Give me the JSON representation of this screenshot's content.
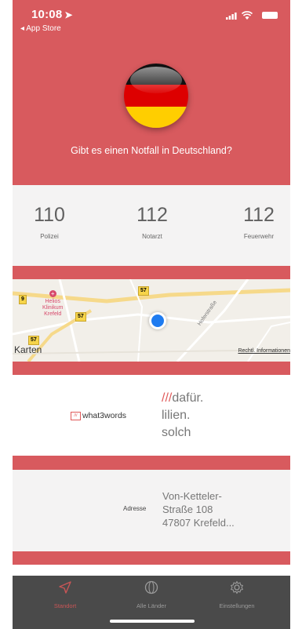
{
  "status_bar": {
    "time": "10:08",
    "back_app": "◂ App Store"
  },
  "header": {
    "question": "Gibt es einen Notfall in Deutschland?",
    "flag_colors": [
      "#000000",
      "#dd0000",
      "#ffce00"
    ]
  },
  "numbers": [
    {
      "number": "110",
      "label": "Polizei"
    },
    {
      "number": "112",
      "label": "Notarzt"
    },
    {
      "number": "112",
      "label": "Feuerwehr"
    }
  ],
  "map": {
    "logo": "Karten",
    "attribution": "Rechtl. Informationen",
    "poi": [
      "Helios",
      "Klinikum",
      "Krefeld"
    ],
    "road_labels": [
      "9",
      "57",
      "57",
      "57"
    ],
    "street": "Hoferstraße"
  },
  "what3words": {
    "brand": "what3words",
    "slashes": "///",
    "words": [
      "dafür.",
      "lilien.",
      "solch"
    ]
  },
  "address": {
    "label": "Adresse",
    "lines": [
      "Von-Ketteler-",
      "Straße 108",
      "47807 Krefeld..."
    ]
  },
  "tabbar": {
    "tabs": [
      {
        "label": "Standort",
        "icon": "location-arrow-icon",
        "active": true
      },
      {
        "label": "Alle Länder",
        "icon": "globe-icon",
        "active": false
      },
      {
        "label": "Einstellungen",
        "icon": "gear-icon",
        "active": false
      }
    ]
  },
  "colors": {
    "accent": "#d85a5e",
    "tabbar": "#4a4a4a",
    "location": "#1e7bf0"
  }
}
